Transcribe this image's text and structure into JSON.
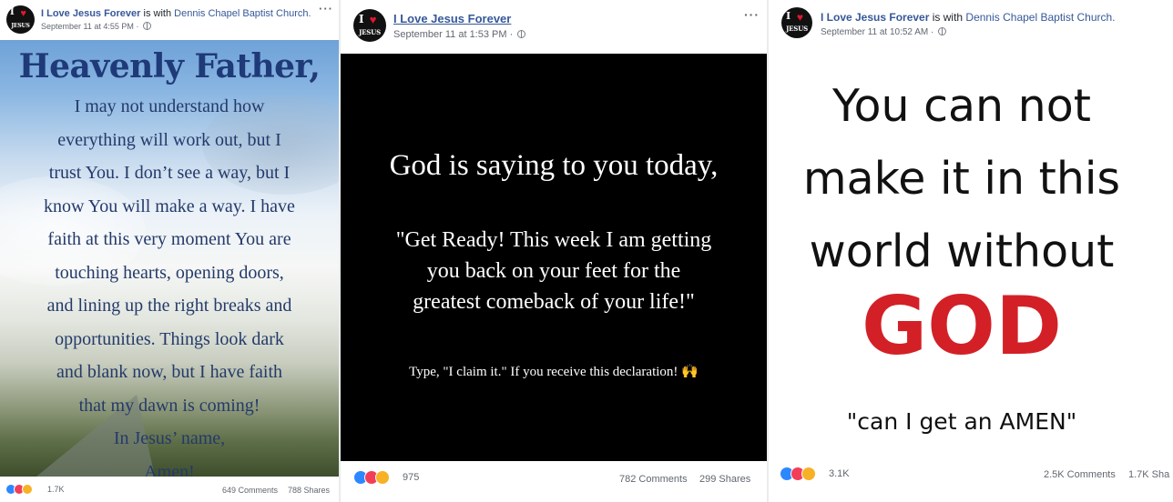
{
  "posts": [
    {
      "page_name": "I Love Jesus Forever",
      "with_text": "is with",
      "place": "Dennis Chapel Baptist Church.",
      "timestamp": "September 11 at 4:55 PM",
      "more": "···",
      "image": {
        "title": "Heavenly Father,",
        "lines": [
          "I may not understand how",
          "everything will work out, but I",
          "trust You. I don’t see a way, but I",
          "know You will make a way. I have",
          "faith at this very moment You are",
          "touching hearts, opening doors,",
          "and lining up the right breaks and",
          "opportunities. Things look dark",
          "and blank now, but I have faith",
          "that my dawn is coming!",
          "In Jesus’ name,",
          "Amen!"
        ]
      },
      "reactions": [
        "like",
        "love",
        "sad"
      ],
      "reaction_count": "1.7K",
      "comments": "649 Comments",
      "shares": "788 Shares"
    },
    {
      "page_name": "I Love Jesus Forever",
      "timestamp": "September 11 at 1:53 PM",
      "more": "···",
      "image": {
        "headline": "God is saying to you today,",
        "quote_lines": [
          "\"Get Ready! This week I am getting",
          "you back on your feet for the",
          "greatest comeback of your life!\""
        ],
        "cta": "Type, \"I claim it.\" If you receive this declaration!",
        "cta_emoji": "🙌"
      },
      "reactions": [
        "like",
        "love",
        "wow"
      ],
      "reaction_count": "975",
      "comments": "782 Comments",
      "shares": "299 Shares"
    },
    {
      "page_name": "I Love Jesus Forever",
      "with_text": "is with",
      "place": "Dennis Chapel Baptist Church.",
      "timestamp": "September 11 at 10:52 AM",
      "image": {
        "lines": [
          "You can not",
          "make it in this",
          "world without"
        ],
        "big_word": "GOD",
        "bottom": "\"can I get an AMEN\""
      },
      "reactions": [
        "like",
        "love",
        "haha"
      ],
      "reaction_count": "3.1K",
      "comments": "2.5K Comments",
      "shares": "1.7K Sha"
    }
  ],
  "avatar": {
    "top": "I",
    "bottom": "JESUS"
  },
  "colors": {
    "link": "#365899",
    "god_red": "#d32026",
    "like": "#2d88ff",
    "love": "#f33e58",
    "yellow": "#f7b125"
  }
}
